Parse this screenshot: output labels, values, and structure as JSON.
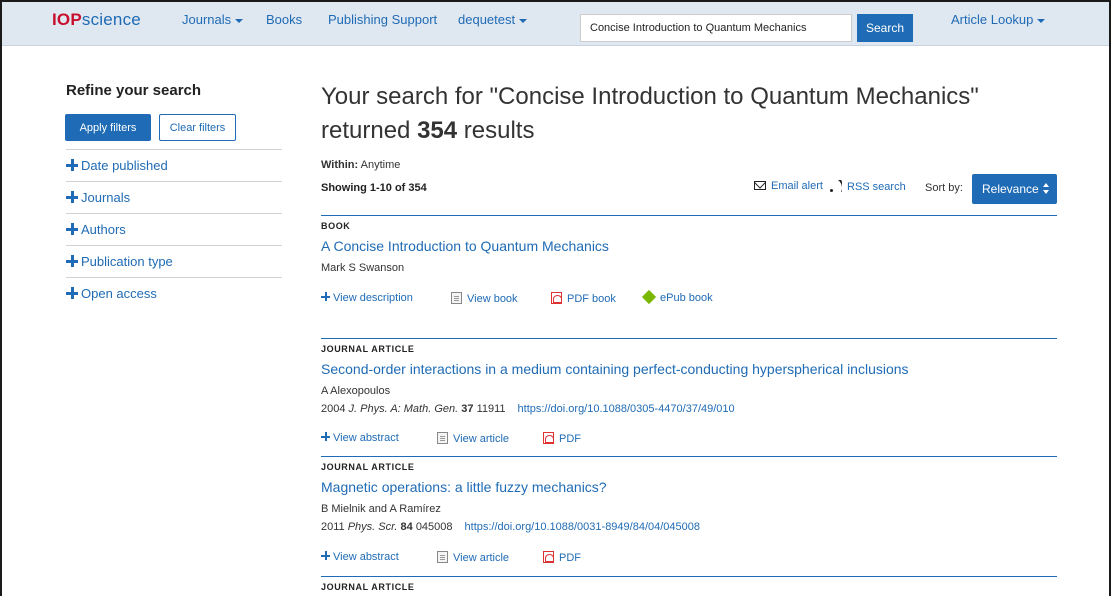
{
  "nav": {
    "logo_bold": "IOP",
    "logo_rest": "science",
    "journals": "Journals",
    "books": "Books",
    "publishing_support": "Publishing Support",
    "user": "dequetest",
    "search_value": "Concise Introduction to Quantum Mechanics",
    "search_button": "Search",
    "article_lookup": "Article Lookup"
  },
  "sidebar": {
    "title": "Refine your search",
    "apply": "Apply filters",
    "clear": "Clear filters",
    "filters": [
      "Date published",
      "Journals",
      "Authors",
      "Publication type",
      "Open access"
    ]
  },
  "main": {
    "heading_prefix": "Your search for \"Concise Introduction to Quantum Mechanics\" returned",
    "count": "354",
    "heading_suffix": "results",
    "within_label": "Within:",
    "within_value": "Anytime",
    "showing": "Showing 1-10 of 354",
    "email_alert": "Email alert",
    "rss_search": "RSS search",
    "sort_label": "Sort by:",
    "sort_value": "Relevance"
  },
  "results": [
    {
      "type": "BOOK",
      "title": "A Concise Introduction to Quantum Mechanics",
      "authors": "Mark S Swanson",
      "actions": [
        "View description",
        "View book",
        "PDF book",
        "ePub book"
      ]
    },
    {
      "type": "JOURNAL ARTICLE",
      "title": "Second-order interactions in a medium containing perfect-conducting hyperspherical inclusions",
      "authors": "A Alexopoulos",
      "year": "2004",
      "journal": "J. Phys. A: Math. Gen.",
      "volume": "37",
      "page": "11911",
      "doi": "https://doi.org/10.1088/0305-4470/37/49/010",
      "actions": [
        "View abstract",
        "View article",
        "PDF"
      ]
    },
    {
      "type": "JOURNAL ARTICLE",
      "title": "Magnetic operations: a little fuzzy mechanics?",
      "authors": "B Mielnik and A Ramírez",
      "year": "2011",
      "journal": "Phys. Scr.",
      "volume": "84",
      "page": "045008",
      "doi": "https://doi.org/10.1088/0031-8949/84/04/045008",
      "actions": [
        "View abstract",
        "View article",
        "PDF"
      ]
    },
    {
      "type": "JOURNAL ARTICLE"
    }
  ],
  "colors": {
    "accent": "#1f6bb5",
    "logo_red": "#c8102e",
    "nav_bg": "#dfe7f1",
    "epub_green": "#7ab800"
  }
}
